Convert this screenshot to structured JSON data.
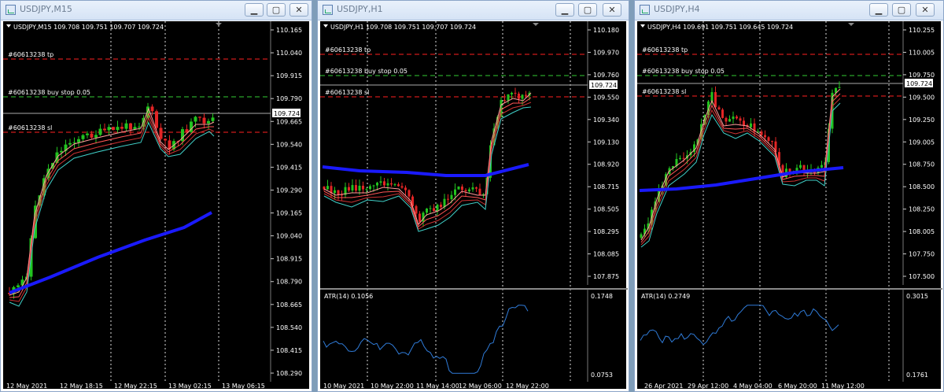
{
  "colors": {
    "background": "#000000",
    "text": "#ffffff",
    "bull": "#22c31f",
    "bear": "#e32525",
    "ma200": "#1a1aff",
    "atr": "#2f7bd8",
    "tp_line": "#ff2020",
    "stop_line": "#33cc33",
    "sl_line": "#ff2020",
    "bid_line": "#aaaaaa"
  },
  "windows": [
    {
      "title": "USDJPY,M15",
      "info": "USDJPY,M15  109.708 109.751 109.707 109.724",
      "price_labels": [
        "110.165",
        "110.040",
        "109.915",
        "109.790",
        "109.665",
        "109.540",
        "109.415",
        "109.290",
        "109.165",
        "109.040",
        "108.915",
        "108.790",
        "108.665",
        "108.540",
        "108.415",
        "108.290"
      ],
      "current_price": "109.724",
      "orders": [
        "#60613238 tp",
        "#60613238 buy stop 0.05",
        "#60613238 sl"
      ],
      "time_labels": [
        "12 May 2021",
        "12 May 18:15",
        "12 May 22:15",
        "13 May 02:15",
        "13 May 06:15"
      ],
      "atr": null
    },
    {
      "title": "USDJPY,H1",
      "info": "USDJPY,H1  109.708 109.751 109.707 109.724",
      "price_labels": [
        "110.180",
        "109.970",
        "109.760",
        "109.550",
        "109.340",
        "109.130",
        "108.920",
        "108.715",
        "108.505",
        "108.295",
        "108.085",
        "107.875"
      ],
      "current_price": "109.724",
      "orders": [
        "#60613238 tp",
        "#60613238 buy stop 0.05",
        "#60613238 sl"
      ],
      "time_labels": [
        "10 May 2021",
        "10 May 22:00",
        "11 May 14:00",
        "12 May 06:00",
        "12 May 22:00"
      ],
      "atr": {
        "label": "ATR(14) 0.1056",
        "max": "0.1748",
        "min": "0.0753"
      }
    },
    {
      "title": "USDJPY,H4",
      "info": "USDJPY,H4  109.691 109.751 109.645 109.724",
      "price_labels": [
        "110.255",
        "110.005",
        "109.750",
        "109.500",
        "109.250",
        "109.005",
        "108.750",
        "108.500",
        "108.250",
        "108.005",
        "107.750",
        "107.500"
      ],
      "current_price": "109.724",
      "orders": [
        "#60613238 tp",
        "#60613238 buy stop 0.05",
        "#60613238 sl"
      ],
      "time_labels": [
        "26 Apr 2021",
        "29 Apr 12:00",
        "4 May 04:00",
        "6 May 20:00",
        "11 May 12:00"
      ],
      "atr": {
        "label": "ATR(14) 0.2749",
        "max": "0.3015",
        "min": "0.1761"
      }
    }
  ]
}
